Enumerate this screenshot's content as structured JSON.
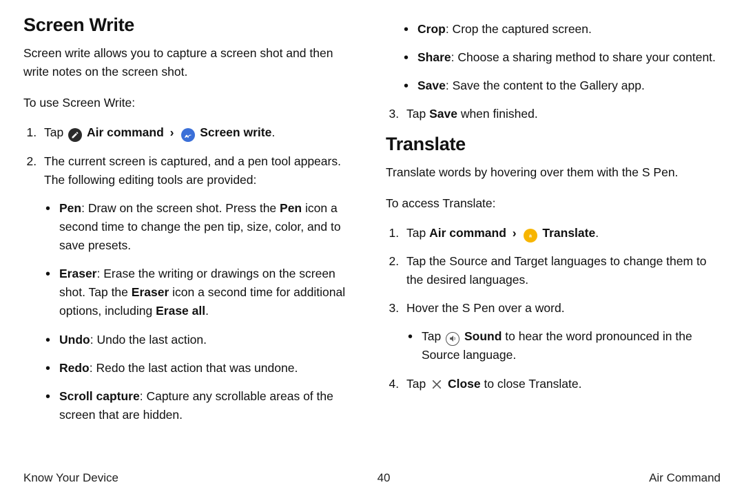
{
  "left": {
    "heading": "Screen Write",
    "intro": "Screen write allows you to capture a screen shot and then write notes on the screen shot.",
    "lead": "To use Screen Write:",
    "step1_prefix": "Tap ",
    "step1_cmd": "Air command",
    "step1_sep": "›",
    "step1_target": "Screen write",
    "step1_suffix": ".",
    "step2": "The current screen is captured, and a pen tool appears. The following editing tools are provided:",
    "tools": {
      "pen_label": "Pen",
      "pen": ": Draw on the screen shot. Press the ",
      "pen_bold2": "Pen",
      "pen_tail": " icon a second time to change the pen tip, size, color, and to save presets.",
      "eraser_label": "Eraser",
      "eraser": ": Erase the writing or drawings on the screen shot. Tap the ",
      "eraser_bold2": "Eraser",
      "eraser_mid": " icon a second time for additional options, including ",
      "eraser_bold3": "Erase all",
      "eraser_tail": ".",
      "undo_label": "Undo",
      "undo": ": Undo the last action.",
      "redo_label": "Redo",
      "redo": ": Redo the last action that was undone.",
      "scroll_label": "Scroll capture",
      "scroll": ": Capture any scrollable areas of the screen that are hidden."
    }
  },
  "right": {
    "tools_cont": {
      "crop_label": "Crop",
      "crop": ": Crop the captured screen.",
      "share_label": "Share",
      "share": ": Choose a sharing method to share your content.",
      "save_label": "Save",
      "save": ": Save the content to the Gallery app."
    },
    "step3_prefix": "Tap ",
    "step3_bold": "Save",
    "step3_suffix": " when finished.",
    "heading": "Translate",
    "intro": "Translate words by hovering over them with the S Pen.",
    "lead": "To access Translate:",
    "t_step1_prefix": "Tap ",
    "t_step1_cmd": "Air command",
    "t_step1_sep": "›",
    "t_step1_target": "Translate",
    "t_step1_suffix": ".",
    "t_step2": "Tap the Source and Target languages to change them to the desired languages.",
    "t_step3": "Hover the S Pen over a word.",
    "t_step3_sub_prefix": "Tap ",
    "t_step3_sub_bold": "Sound",
    "t_step3_sub_suffix": " to hear the word pronounced in the Source language.",
    "t_step4_prefix": "Tap ",
    "t_step4_bold": "Close",
    "t_step4_suffix": " to close Translate."
  },
  "footer": {
    "left": "Know Your Device",
    "center": "40",
    "right": "Air Command"
  }
}
